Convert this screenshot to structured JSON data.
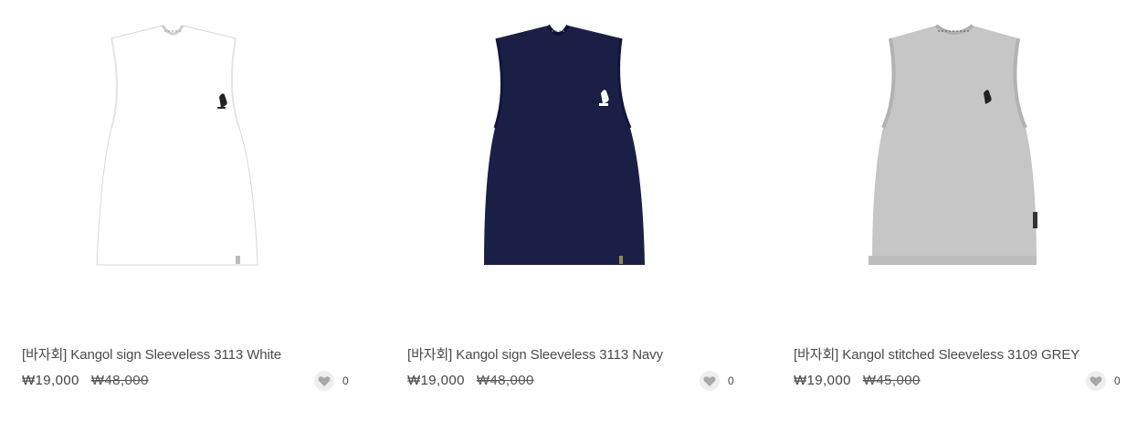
{
  "products": [
    {
      "name": "[바자회] Kangol sign Sleeveless 3113 White",
      "price": "₩19,000",
      "original_price": "₩48,000",
      "likes": "0",
      "image": "white-sleeveless-shirt",
      "shirt_color": "#ffffff"
    },
    {
      "name": "[바자회] Kangol sign Sleeveless 3113 Navy",
      "price": "₩19,000",
      "original_price": "₩48,000",
      "likes": "0",
      "image": "navy-sleeveless-shirt",
      "shirt_color": "#1c1f45"
    },
    {
      "name": "[바자회] Kangol stitched Sleeveless 3109 GREY",
      "price": "₩19,000",
      "original_price": "₩45,000",
      "likes": "0",
      "image": "grey-sleeveless-shirt",
      "shirt_color": "#c6c6c6"
    }
  ],
  "icons": {
    "like": "heart-icon",
    "logo": "kangaroo-logo-icon"
  }
}
